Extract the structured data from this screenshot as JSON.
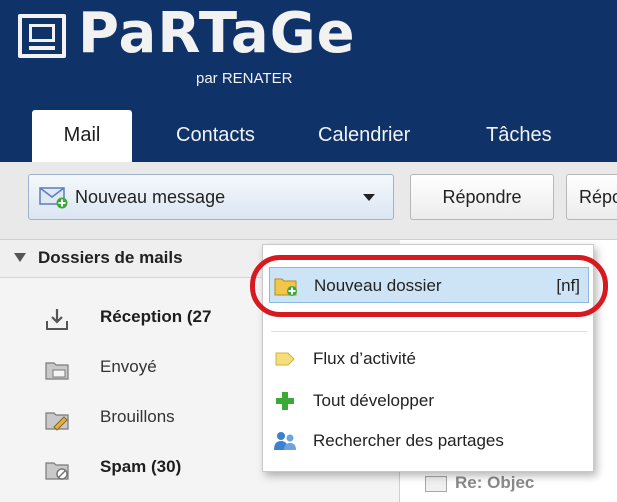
{
  "brand": {
    "name": "PaRTaGe",
    "subtitle": "par RENATER"
  },
  "tabs": [
    {
      "label": "Mail",
      "active": true
    },
    {
      "label": "Contacts",
      "active": false
    },
    {
      "label": "Calendrier",
      "active": false
    },
    {
      "label": "Tâches",
      "active": false
    }
  ],
  "toolbar": {
    "new_message_label": "Nouveau message",
    "reply_label": "Répondre",
    "reply_all_label": "Répo"
  },
  "folders": {
    "header": "Dossiers de mails",
    "items": [
      {
        "label": "Réception (27",
        "bold": true,
        "icon": "inbox-icon"
      },
      {
        "label": "Envoyé",
        "bold": false,
        "icon": "sent-icon"
      },
      {
        "label": "Brouillons",
        "bold": false,
        "icon": "drafts-icon"
      },
      {
        "label": "Spam (30)",
        "bold": true,
        "icon": "spam-icon"
      }
    ]
  },
  "context_menu": {
    "items": [
      {
        "label": "Nouveau dossier",
        "shortcut": "[nf]",
        "icon": "new-folder-icon",
        "highlighted": true
      },
      {
        "label": "Flux d’activité",
        "icon": "activity-stream-icon"
      },
      {
        "label": "Tout développer",
        "icon": "expand-all-icon"
      },
      {
        "label": "Rechercher des partages",
        "icon": "find-shares-icon"
      }
    ]
  },
  "message_preview": {
    "subject_snippet": "Re: Objec"
  },
  "colors": {
    "header_bg": "#0f3269",
    "highlight_bg": "#cde4f7",
    "annotation_red": "#d71920"
  }
}
